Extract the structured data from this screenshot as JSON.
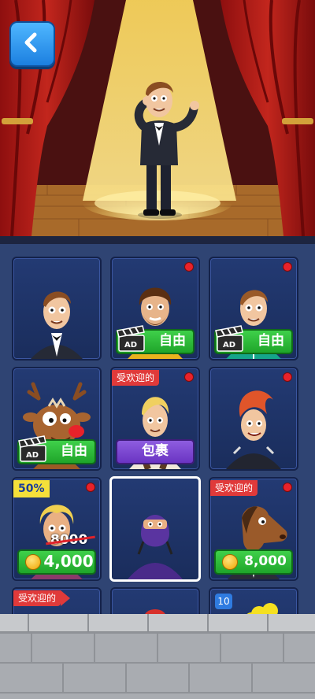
{
  "header": {
    "back_button_icon": "chevron-left-icon"
  },
  "shop": {
    "cards": [
      {
        "id": "tuxedo",
        "button": null
      },
      {
        "id": "bearded",
        "button": {
          "type": "ad-free",
          "label": "自由"
        },
        "new_dot": true
      },
      {
        "id": "tracksuit",
        "button": {
          "type": "ad-free",
          "label": "自由"
        },
        "new_dot": true
      },
      {
        "id": "reindeer",
        "button": {
          "type": "ad-free",
          "label": "自由"
        }
      },
      {
        "id": "blonde-vest",
        "tag": "受欢迎的",
        "button": {
          "type": "package",
          "label": "包裹"
        },
        "new_dot": true
      },
      {
        "id": "punk",
        "button": null,
        "new_dot": true
      },
      {
        "id": "curly-blonde",
        "discount": "50%",
        "old_price": "8000",
        "button": {
          "type": "coin",
          "label": "4,000"
        },
        "new_dot": true
      },
      {
        "id": "ninja",
        "selected": true,
        "button": null
      },
      {
        "id": "horse-head",
        "tag": "受欢迎的",
        "button": {
          "type": "coin",
          "label": "8,000"
        },
        "new_dot": true
      },
      {
        "id": "partial-1",
        "tag": "受欢迎的"
      },
      {
        "id": "partial-2",
        "new_dot": true
      },
      {
        "id": "partial-3",
        "count": "10"
      }
    ]
  },
  "colors": {
    "accent_green": "#1fa52a",
    "accent_purple": "#6a34c2",
    "accent_blue": "#1c7fe0",
    "tag_red": "#e03a3a",
    "dot_red": "#e8222a"
  }
}
